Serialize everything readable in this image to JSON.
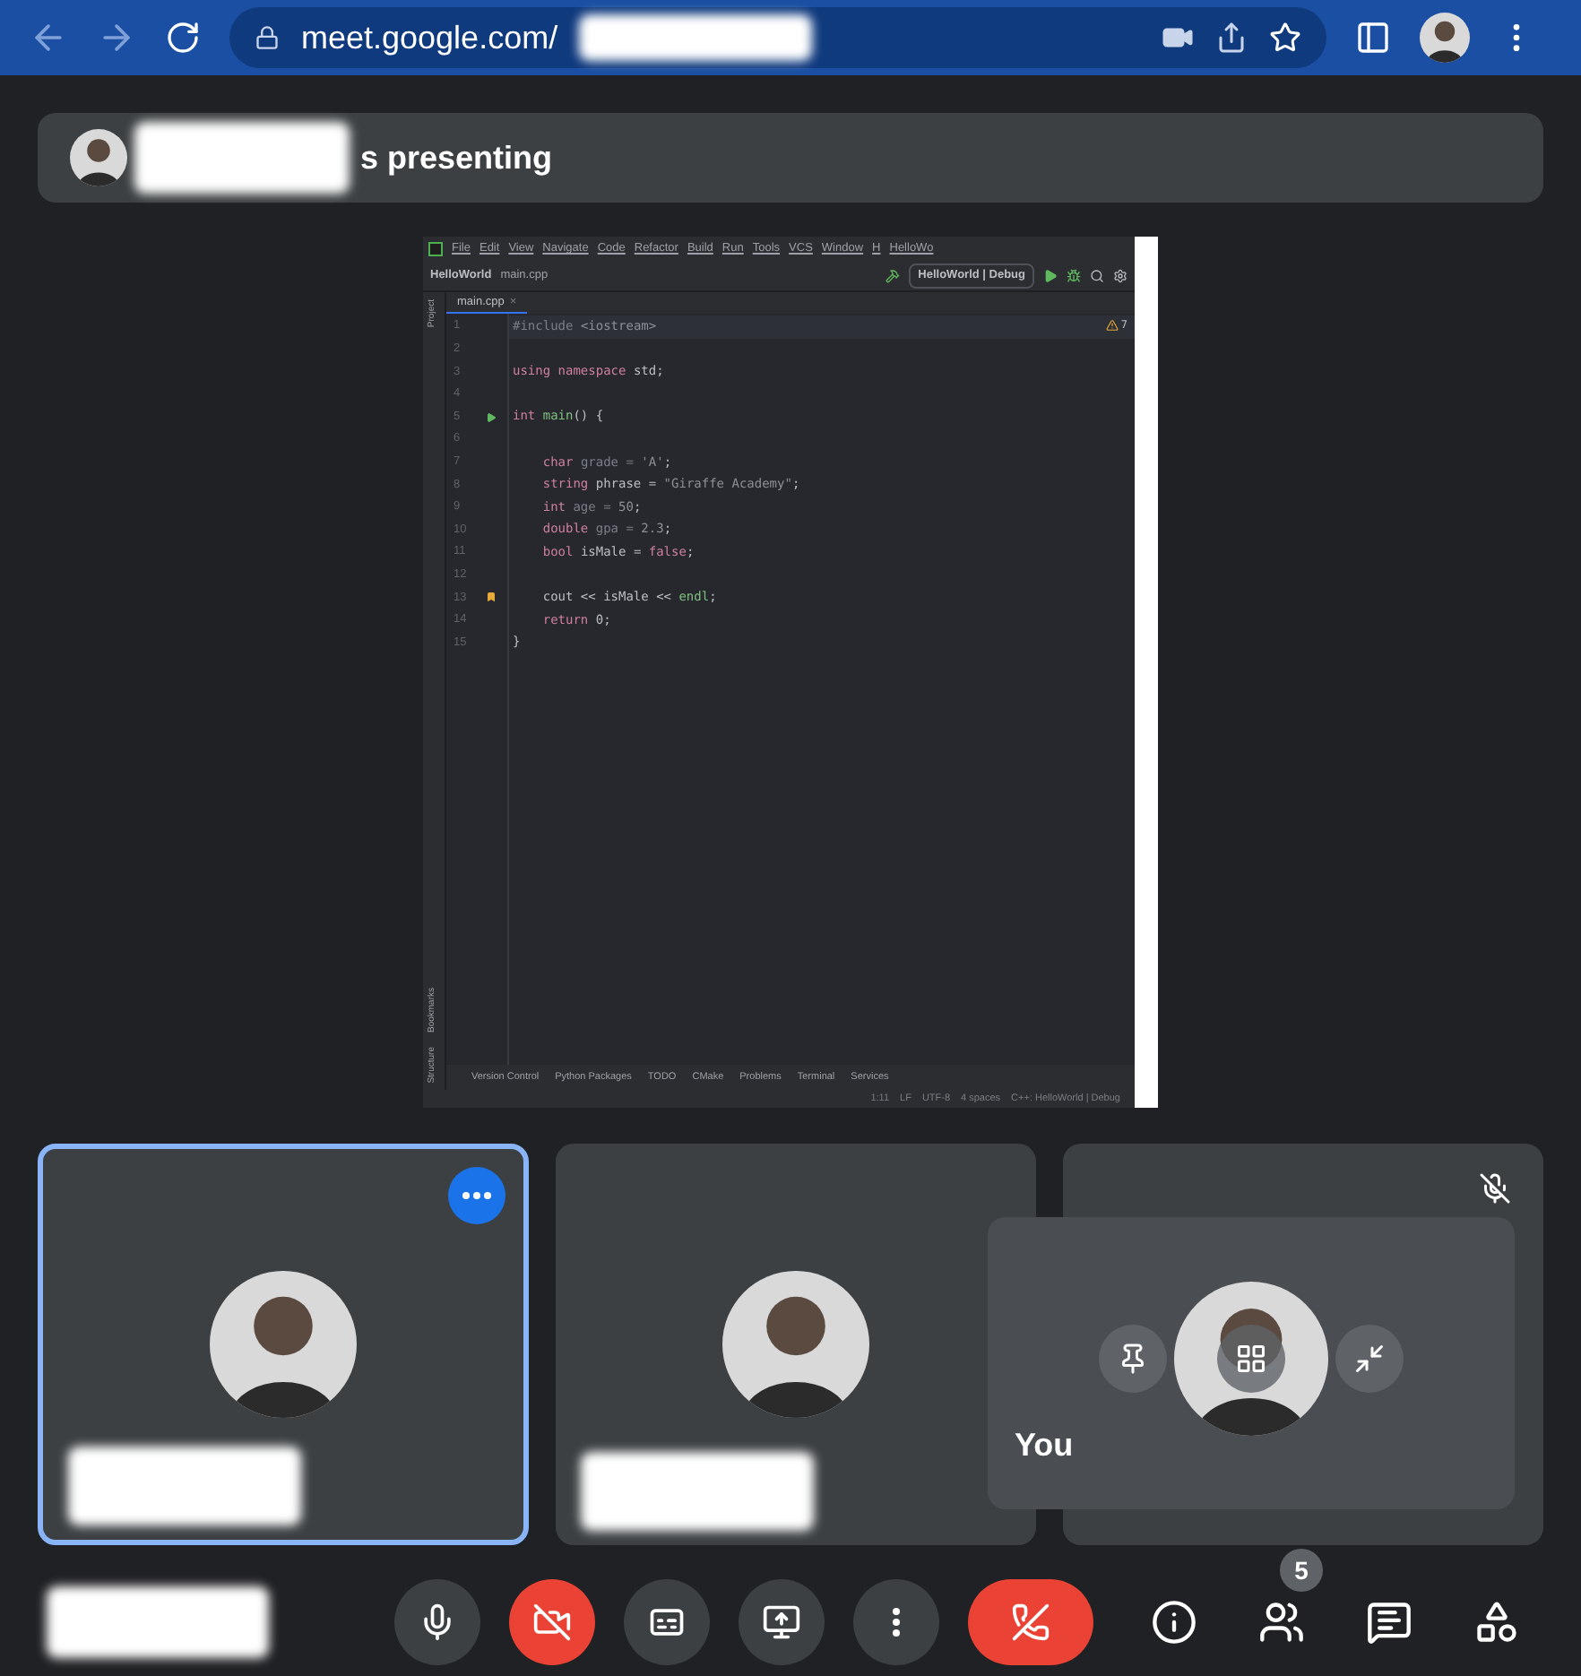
{
  "browser": {
    "url": "meet.google.com/"
  },
  "banner": {
    "text": "s presenting"
  },
  "ide": {
    "menu": [
      "File",
      "Edit",
      "View",
      "Navigate",
      "Code",
      "Refactor",
      "Build",
      "Run",
      "Tools",
      "VCS",
      "Window",
      "H",
      "HelloWo"
    ],
    "project": "HelloWorld",
    "file": "main.cpp",
    "config": "HelloWorld | Debug",
    "tab": "main.cpp",
    "close": "×",
    "warnings": "7",
    "side": [
      "Project",
      "Bookmarks",
      "Structure"
    ],
    "lines": [
      {
        "num": "1",
        "tokens": [
          {
            "t": "#include ",
            "kind": "dim"
          },
          {
            "t": "<iostream>",
            "kind": "str"
          }
        ]
      },
      {
        "num": "2"
      },
      {
        "num": "3",
        "tokens": [
          {
            "t": "using namespace ",
            "kind": "kw"
          },
          {
            "t": "std;",
            "kind": "plain"
          }
        ]
      },
      {
        "num": "4"
      },
      {
        "num": "5",
        "tokens": [
          {
            "t": "int ",
            "kind": "kw"
          },
          {
            "t": "main",
            "kind": "fn"
          },
          {
            "t": "() {",
            "kind": "plain"
          }
        ],
        "run": true
      },
      {
        "num": "6"
      },
      {
        "num": "7",
        "tokens": [
          {
            "t": "    char ",
            "kind": "kw"
          },
          {
            "t": "grade = ",
            "kind": "dim"
          },
          {
            "t": "'A'",
            "kind": "str"
          },
          {
            "t": ";",
            "kind": "plain"
          }
        ]
      },
      {
        "num": "8",
        "tokens": [
          {
            "t": "    string ",
            "kind": "kw"
          },
          {
            "t": "phrase = ",
            "kind": "plain"
          },
          {
            "t": "\"Giraffe Academy\"",
            "kind": "str"
          },
          {
            "t": ";",
            "kind": "plain"
          }
        ]
      },
      {
        "num": "9",
        "tokens": [
          {
            "t": "    int ",
            "kind": "kw"
          },
          {
            "t": "age = ",
            "kind": "dim"
          },
          {
            "t": "50",
            "kind": "str"
          },
          {
            "t": ";",
            "kind": "plain"
          }
        ]
      },
      {
        "num": "10",
        "tokens": [
          {
            "t": "    double ",
            "kind": "kw"
          },
          {
            "t": "gpa = ",
            "kind": "dim"
          },
          {
            "t": "2.3",
            "kind": "str"
          },
          {
            "t": ";",
            "kind": "plain"
          }
        ]
      },
      {
        "num": "11",
        "tokens": [
          {
            "t": "    bool ",
            "kind": "kw"
          },
          {
            "t": "isMale = ",
            "kind": "plain"
          },
          {
            "t": "false",
            "kind": "kw"
          },
          {
            "t": ";",
            "kind": "plain"
          }
        ]
      },
      {
        "num": "12"
      },
      {
        "num": "13",
        "tokens": [
          {
            "t": "    cout << isMale << ",
            "kind": "plain"
          },
          {
            "t": "endl",
            "kind": "fn"
          },
          {
            "t": ";",
            "kind": "plain"
          }
        ],
        "bookmark": true
      },
      {
        "num": "14",
        "tokens": [
          {
            "t": "    return ",
            "kind": "kw"
          },
          {
            "t": "0;",
            "kind": "plain"
          }
        ]
      },
      {
        "num": "15",
        "tokens": [
          {
            "t": "}",
            "kind": "plain"
          }
        ]
      }
    ],
    "tools": [
      "Version Control",
      "Python Packages",
      "TODO",
      "CMake",
      "Problems",
      "Terminal",
      "Services"
    ],
    "status": [
      "1:11",
      "LF",
      "UTF-8",
      "4 spaces",
      "C++: HelloWorld | Debug"
    ]
  },
  "tiles": [
    {
      "selected": true,
      "muted": false,
      "more": true
    },
    {
      "selected": false,
      "muted": false,
      "more": false
    },
    {
      "selected": false,
      "muted": true,
      "more": false
    }
  ],
  "self_view": {
    "label": "You"
  },
  "controls": [
    {
      "kind": "mic",
      "alert": false
    },
    {
      "kind": "camera",
      "alert": true
    },
    {
      "kind": "captions",
      "alert": false
    },
    {
      "kind": "present",
      "alert": false
    },
    {
      "kind": "more",
      "alert": false
    },
    {
      "kind": "leave",
      "alert": true
    }
  ],
  "side_controls": [
    {
      "kind": "info"
    },
    {
      "kind": "people",
      "badge": "5"
    },
    {
      "kind": "chat"
    },
    {
      "kind": "activities"
    }
  ]
}
